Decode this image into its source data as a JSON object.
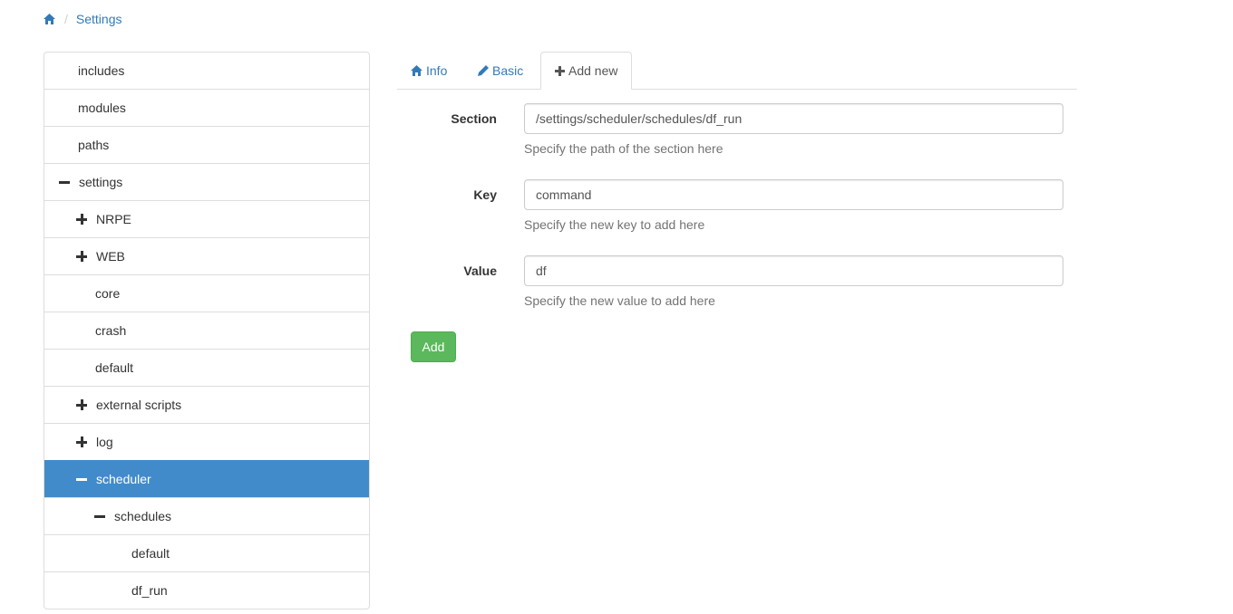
{
  "breadcrumb": {
    "home_icon": "home-icon",
    "current": "Settings"
  },
  "tree": {
    "items": [
      {
        "label": "includes",
        "level": 0,
        "toggle": "none",
        "active": false
      },
      {
        "label": "modules",
        "level": 0,
        "toggle": "none",
        "active": false
      },
      {
        "label": "paths",
        "level": 0,
        "toggle": "none",
        "active": false
      },
      {
        "label": "settings",
        "level": 0,
        "toggle": "minus",
        "active": false
      },
      {
        "label": "NRPE",
        "level": 1,
        "toggle": "plus",
        "active": false
      },
      {
        "label": "WEB",
        "level": 1,
        "toggle": "plus",
        "active": false
      },
      {
        "label": "core",
        "level": 1,
        "toggle": "none",
        "active": false
      },
      {
        "label": "crash",
        "level": 1,
        "toggle": "none",
        "active": false
      },
      {
        "label": "default",
        "level": 1,
        "toggle": "none",
        "active": false
      },
      {
        "label": "external scripts",
        "level": 1,
        "toggle": "plus",
        "active": false
      },
      {
        "label": "log",
        "level": 1,
        "toggle": "plus",
        "active": false
      },
      {
        "label": "scheduler",
        "level": 1,
        "toggle": "minus",
        "active": true
      },
      {
        "label": "schedules",
        "level": 2,
        "toggle": "minus",
        "active": false
      },
      {
        "label": "default",
        "level": 3,
        "toggle": "none",
        "active": false
      },
      {
        "label": "df_run",
        "level": 3,
        "toggle": "none",
        "active": false
      }
    ]
  },
  "tabs": {
    "info": {
      "label": "Info",
      "icon": "home-icon"
    },
    "basic": {
      "label": "Basic",
      "icon": "pencil-icon"
    },
    "add_new": {
      "label": "Add new",
      "icon": "plus-icon"
    }
  },
  "form": {
    "section": {
      "label": "Section",
      "value": "/settings/scheduler/schedules/df_run",
      "help": "Specify the path of the section here"
    },
    "key": {
      "label": "Key",
      "value": "command",
      "help": "Specify the new key to add here"
    },
    "value": {
      "label": "Value",
      "value": "df",
      "help": "Specify the new value to add here"
    },
    "submit_label": "Add"
  },
  "colors": {
    "link": "#337ab7",
    "active_item": "#428bca",
    "success": "#5cb85c"
  }
}
